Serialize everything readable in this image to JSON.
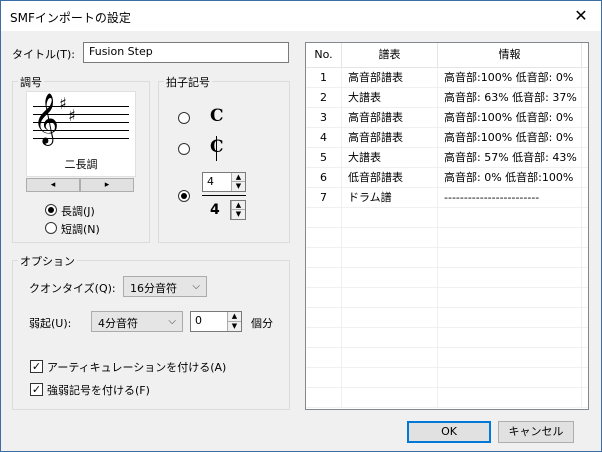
{
  "window": {
    "title": "SMFインポートの設定",
    "close_glyph": "✕"
  },
  "title_field": {
    "label": "タイトル(T):",
    "value": "Fusion Step"
  },
  "key_group": {
    "legend": "調号",
    "key_name": "二長調",
    "left_arrow": "◂",
    "right_arrow": "▸",
    "major_label": "長調(J)",
    "minor_label": "短調(N)",
    "selected": "major",
    "treble_clef": "𝄞",
    "sharp": "♯"
  },
  "time_group": {
    "legend": "拍子記号",
    "common_time": "C",
    "cut_time": "C",
    "numerator": "4",
    "denominator": "4",
    "selected": "custom"
  },
  "options_group": {
    "legend": "オプション",
    "quantize_label": "クオンタイズ(Q):",
    "quantize_value": "16分音符",
    "upbeat_label": "弱起(U):",
    "upbeat_value": "4分音符",
    "upbeat_count": "0",
    "upbeat_unit": "個分",
    "articulation_label": "アーティキュレーションを付ける(A)",
    "articulation_checked": true,
    "dynamics_label": "強弱記号を付ける(F)",
    "dynamics_checked": true,
    "check_glyph": "✓",
    "combo_arrow": "⌵",
    "spin_up": "▲",
    "spin_down": "▼"
  },
  "table": {
    "headers": [
      "No.",
      "譜表",
      "情報"
    ],
    "rows": [
      [
        "1",
        "高音部譜表",
        "高音部:100%  低音部:  0%"
      ],
      [
        "2",
        "大譜表",
        "高音部: 63%  低音部: 37%"
      ],
      [
        "3",
        "高音部譜表",
        "高音部:100%  低音部:  0%"
      ],
      [
        "4",
        "高音部譜表",
        "高音部:100%  低音部:  0%"
      ],
      [
        "5",
        "大譜表",
        "高音部: 57%  低音部: 43%"
      ],
      [
        "6",
        "低音部譜表",
        "高音部:  0%  低音部:100%"
      ],
      [
        "7",
        "ドラム譜",
        "------------------------"
      ]
    ]
  },
  "buttons": {
    "ok": "OK",
    "cancel": "キャンセル"
  }
}
